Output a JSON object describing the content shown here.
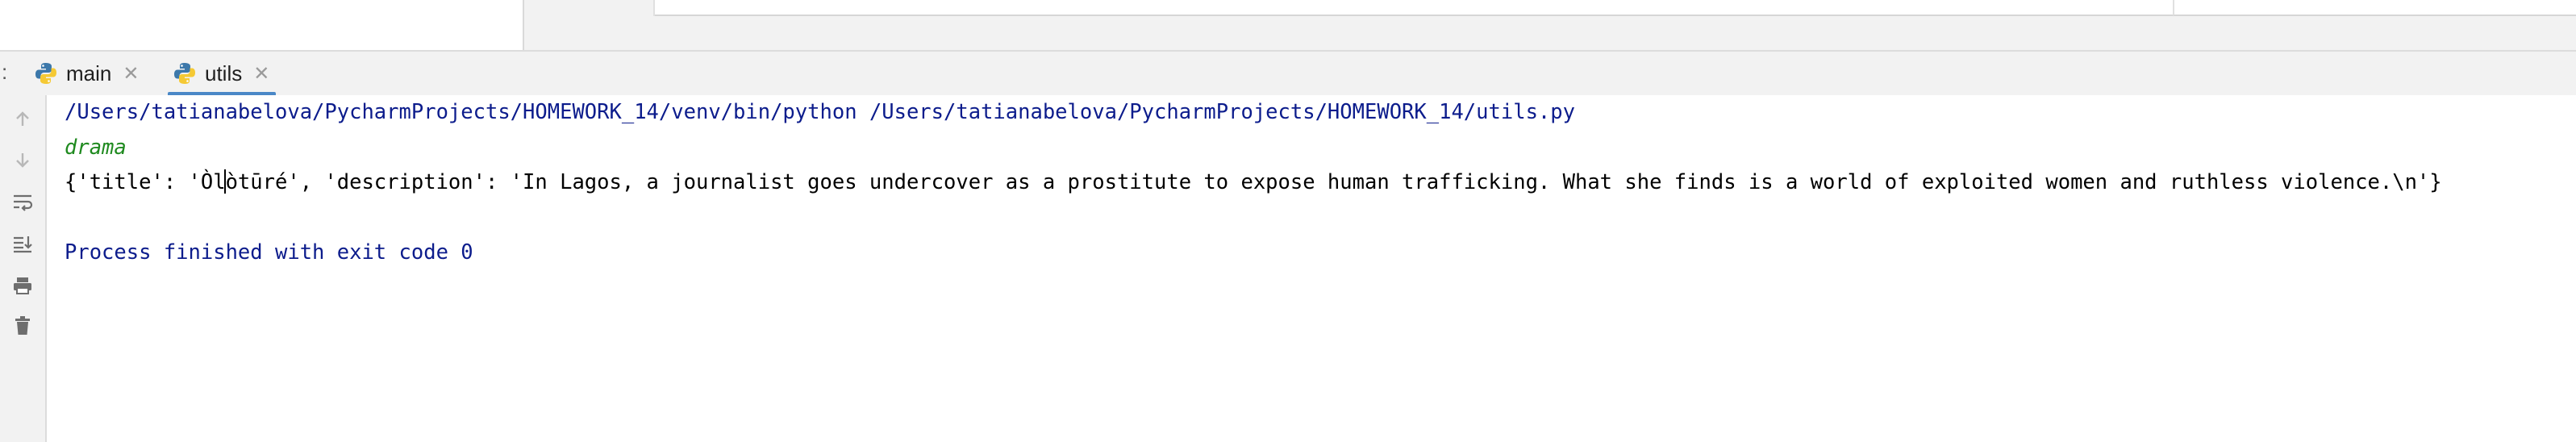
{
  "tabs": [
    {
      "label": "main",
      "active": false,
      "icon": "python-file-icon"
    },
    {
      "label": "utils",
      "active": true,
      "icon": "python-file-icon"
    }
  ],
  "tab_bar": {
    "prefix": ":"
  },
  "toolbar": {
    "items": [
      "up-arrow-icon",
      "down-arrow-icon",
      "soft-wrap-icon",
      "scroll-to-end-icon",
      "print-icon",
      "trash-icon"
    ]
  },
  "console": {
    "command": "/Users/tatianabelova/PycharmProjects/HOMEWORK_14/venv/bin/python /Users/tatianabelova/PycharmProjects/HOMEWORK_14/utils.py",
    "output_genre": "drama",
    "output_dict": "{'title': 'Òlòtūré', 'description': 'In Lagos, a journalist goes undercover as a prostitute to expose human trafficking. What she finds is a world of exploited women and ruthless violence.\\n'}",
    "exit_message": "Process finished with exit code 0"
  },
  "colors": {
    "accent": "#4a88c7",
    "command_text": "#0c1c8c",
    "genre_text": "#1f8a1f"
  }
}
